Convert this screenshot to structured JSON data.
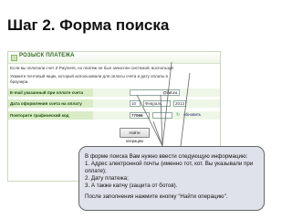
{
  "slide": {
    "title": "Шаг 2. Форма поиска"
  },
  "form": {
    "header_title": "РОЗЫСК ПЛАТЕЖА",
    "intro_line": "Если вы оплатили счет Z-Payment, но платеж не был зачислен системой, воспользуй",
    "instruction_line1": "Укажите почтовый ящик, который использовали для оплаты счета и дату оплаты в",
    "instruction_line2": "браузера.",
    "rows": [
      {
        "label": "E-mail указанный при оплате счета",
        "email_value": "@list.ru"
      },
      {
        "label": "Дата оформления счета на оплату",
        "day": "10",
        "month": "Февраль",
        "year": "2013"
      },
      {
        "label": "Повторите графический код",
        "captcha": "77066",
        "refresh_label": "обновить"
      }
    ],
    "find_button": "Найти операцию"
  },
  "callout": {
    "lines": [
      "В форме поиска Вам нужно ввести следующую информацию:",
      "1. Адрес электронной почты (именно тот, кот. Вы указывали при",
      "оплате);",
      "2. Дату платежа;",
      "3. А также капчу (защита от ботов)."
    ],
    "footer": "После заполнения нажмите кнопку \"Найти операцию\"."
  }
}
